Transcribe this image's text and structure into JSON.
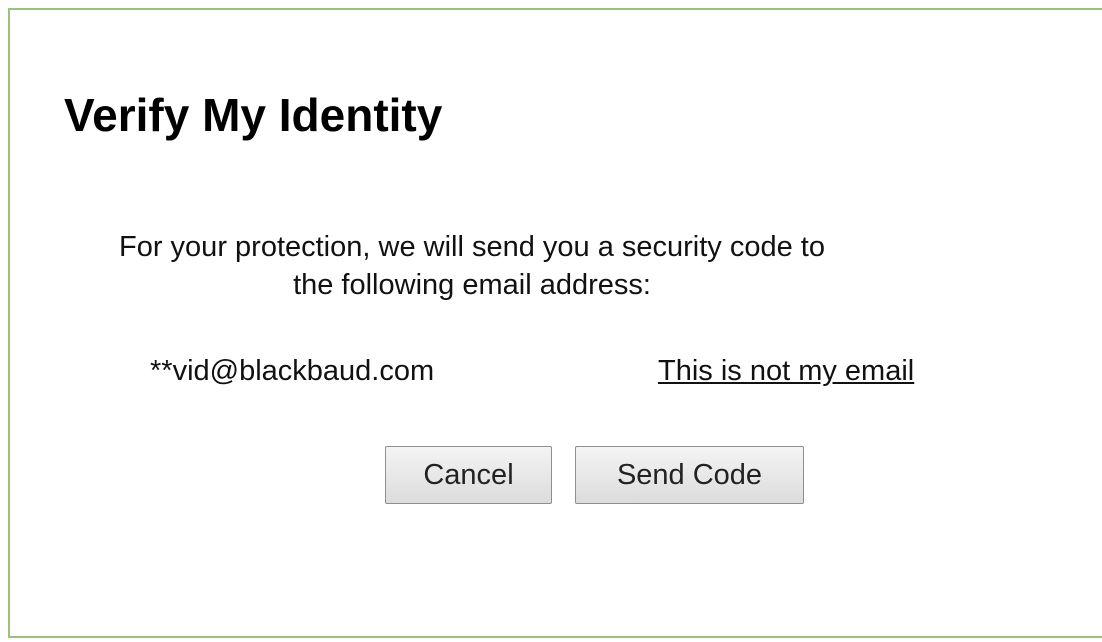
{
  "dialog": {
    "title": "Verify My Identity",
    "message": "For your protection, we will send you a security code to the following email address:",
    "masked_email": "**vid@blackbaud.com",
    "not_my_email_link": "This is not my email",
    "cancel_label": "Cancel",
    "send_code_label": "Send Code",
    "border_color": "#9cc17a"
  }
}
